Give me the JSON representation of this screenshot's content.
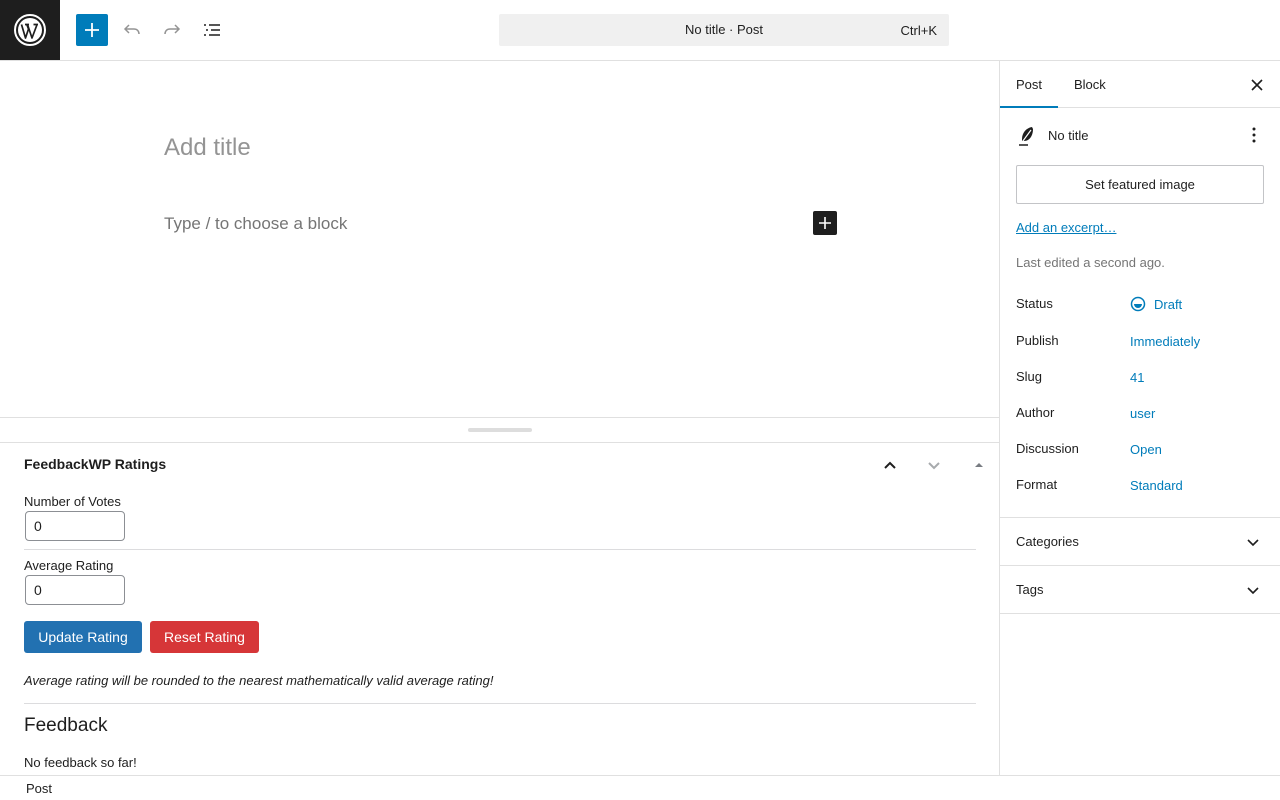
{
  "toolbar": {
    "document_title": "No title · Post",
    "shortcut": "Ctrl+K"
  },
  "editor": {
    "title_placeholder": "Add title",
    "block_placeholder": "Type / to choose a block"
  },
  "metabox": {
    "title": "FeedbackWP Ratings",
    "votes_label": "Number of Votes",
    "votes_value": "0",
    "rating_label": "Average Rating",
    "rating_value": "0",
    "update_button": "Update Rating",
    "reset_button": "Reset Rating",
    "note": "Average rating will be rounded to the nearest mathematically valid average rating!",
    "feedback_heading": "Feedback",
    "feedback_empty": "No feedback so far!"
  },
  "footer": {
    "breadcrumb": "Post"
  },
  "sidebar": {
    "tabs": [
      {
        "label": "Post",
        "active": true
      },
      {
        "label": "Block",
        "active": false
      }
    ],
    "post_title": "No title",
    "featured_image_button": "Set featured image",
    "excerpt_link": "Add an excerpt…",
    "last_edited": "Last edited a second ago.",
    "meta": [
      {
        "label": "Status",
        "value": "Draft"
      },
      {
        "label": "Publish",
        "value": "Immediately"
      },
      {
        "label": "Slug",
        "value": "41"
      },
      {
        "label": "Author",
        "value": "user"
      },
      {
        "label": "Discussion",
        "value": "Open"
      },
      {
        "label": "Format",
        "value": "Standard"
      }
    ],
    "panels": [
      {
        "label": "Categories"
      },
      {
        "label": "Tags"
      }
    ]
  },
  "colors": {
    "accent": "#007cba",
    "update_button": "#2271b1",
    "reset_button": "#d63638",
    "dark": "#1e1e1e"
  }
}
